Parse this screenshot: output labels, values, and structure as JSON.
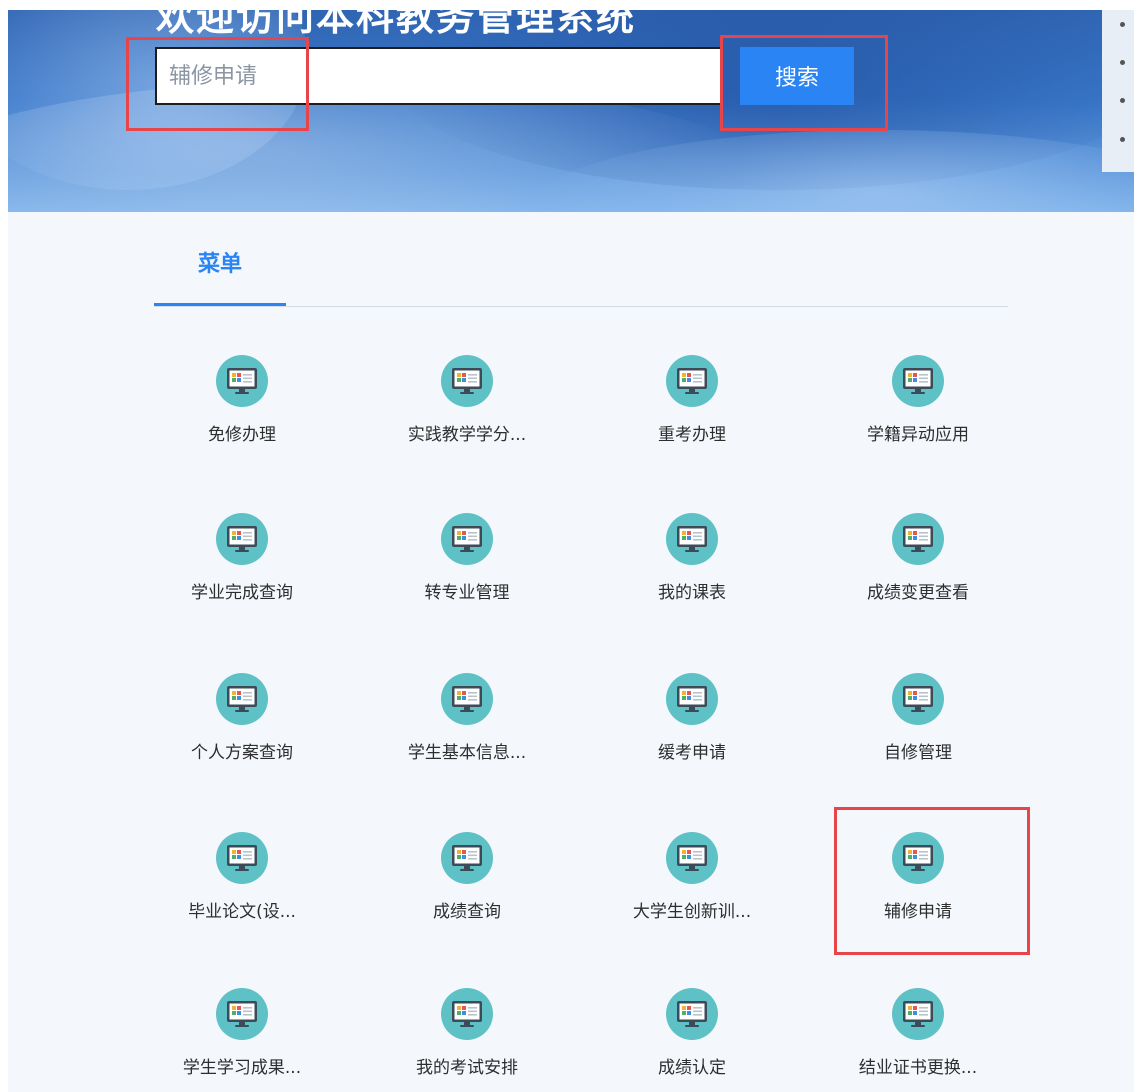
{
  "banner": {
    "title": "欢迎访问本科教务管理系统",
    "search": {
      "placeholder": "辅修申请",
      "button_label": "搜索"
    }
  },
  "menu": {
    "tab_label": "菜单",
    "items": [
      {
        "label": "免修办理",
        "icon": "computer-icon"
      },
      {
        "label": "实践教学学分...",
        "icon": "computer-icon"
      },
      {
        "label": "重考办理",
        "icon": "computer-icon"
      },
      {
        "label": "学籍异动应用",
        "icon": "computer-icon"
      },
      {
        "label": "学业完成查询",
        "icon": "computer-icon"
      },
      {
        "label": "转专业管理",
        "icon": "computer-icon"
      },
      {
        "label": "我的课表",
        "icon": "computer-icon"
      },
      {
        "label": "成绩变更查看",
        "icon": "computer-icon"
      },
      {
        "label": "个人方案查询",
        "icon": "computer-icon"
      },
      {
        "label": "学生基本信息...",
        "icon": "computer-icon"
      },
      {
        "label": "缓考申请",
        "icon": "computer-icon"
      },
      {
        "label": "自修管理",
        "icon": "computer-icon"
      },
      {
        "label": "毕业论文(设...",
        "icon": "computer-icon"
      },
      {
        "label": "成绩查询",
        "icon": "computer-icon"
      },
      {
        "label": "大学生创新训...",
        "icon": "computer-icon"
      },
      {
        "label": "辅修申请",
        "icon": "computer-icon"
      },
      {
        "label": "学生学习成果...",
        "icon": "computer-icon"
      },
      {
        "label": "我的考试安排",
        "icon": "computer-icon"
      },
      {
        "label": "成绩认定",
        "icon": "computer-icon"
      },
      {
        "label": "结业证书更换...",
        "icon": "computer-icon"
      }
    ]
  },
  "colors": {
    "accent": "#2b84f3",
    "highlight": "#e8454a",
    "icon_bg": "#5ec1c6",
    "banner": "#3a78c9"
  }
}
